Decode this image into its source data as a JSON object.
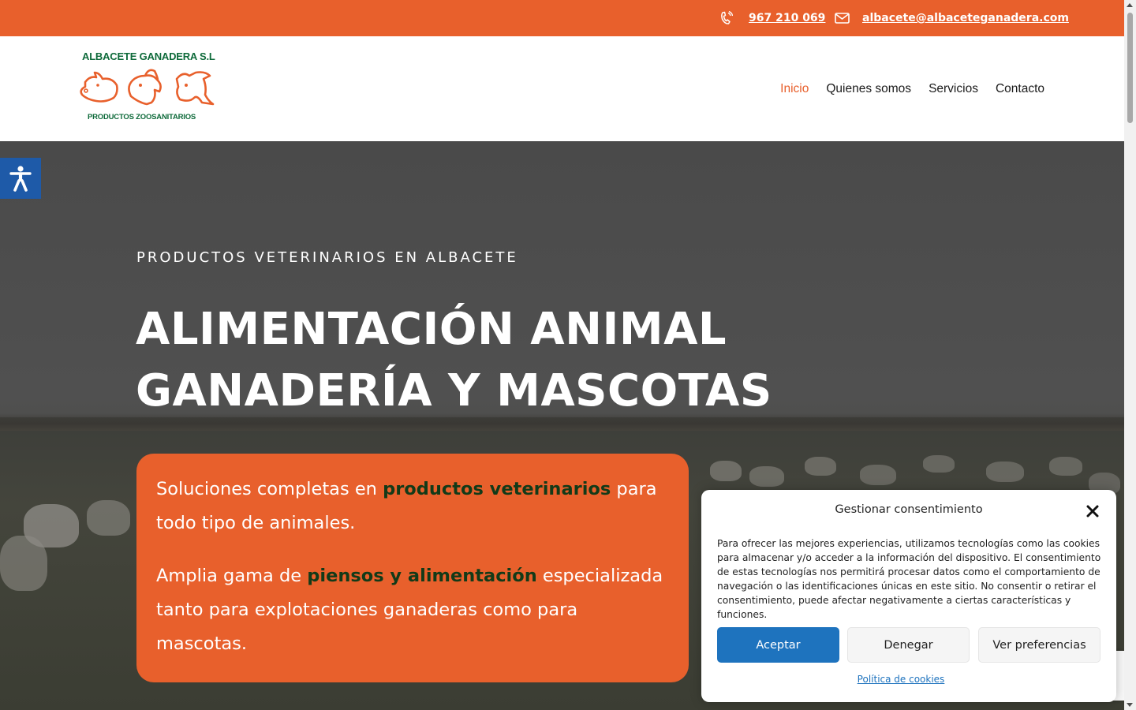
{
  "topbar": {
    "phone": "967 210 069",
    "email": "albacete@albaceteganadera.com",
    "icons": [
      "phone-icon",
      "mail-icon"
    ]
  },
  "header": {
    "logo_title": "ALBACETE GANADERA S.L",
    "logo_subtitle": "PRODUCTOS ZOOSANITARIOS",
    "nav": [
      {
        "label": "Inicio",
        "active": true
      },
      {
        "label": "Quienes somos",
        "active": false
      },
      {
        "label": "Servicios",
        "active": false
      },
      {
        "label": "Contacto",
        "active": false
      }
    ]
  },
  "hero": {
    "kicker": "PRODUCTOS VETERINARIOS EN ALBACETE",
    "title_line1": "ALIMENTACIÓN ANIMAL",
    "title_line2": "GANADERÍA Y MASCOTAS",
    "p1_before": "Soluciones completas en ",
    "p1_bold": "productos veterinarios",
    "p1_after": " para todo tipo de animales.",
    "p2_before": "Amplia gama de ",
    "p2_bold": "piensos y alimentación",
    "p2_after": " especializada tanto para explotaciones ganaderas como para mascotas."
  },
  "cookie": {
    "title": "Gestionar consentimiento",
    "text": "Para ofrecer las mejores experiencias, utilizamos tecnologías como las cookies para almacenar y/o acceder a la información del dispositivo. El consentimiento de estas tecnologías nos permitirá procesar datos como el comportamiento de navegación o las identificaciones únicas en este sitio. No consentir o retirar el consentimiento, puede afectar negativamente a ciertas características y funciones.",
    "accept": "Aceptar",
    "deny": "Denegar",
    "preferences": "Ver preferencias",
    "policy_link": "Política de cookies"
  },
  "colors": {
    "brand_orange": "#e8602c",
    "brand_green": "#0e6a3a",
    "accept_blue": "#1e73be",
    "a11y_blue": "#1e5aa8"
  }
}
